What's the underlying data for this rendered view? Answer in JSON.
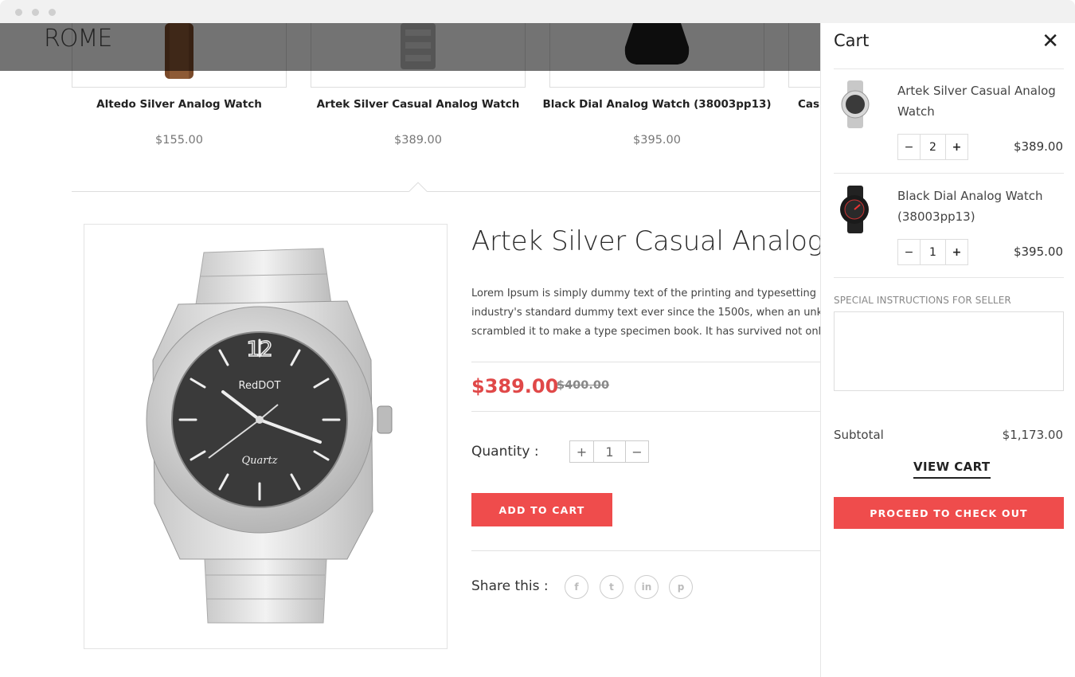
{
  "header": {
    "logo": "ROME"
  },
  "related": [
    {
      "name": "Altedo Silver Analog Watch",
      "price": "$155.00"
    },
    {
      "name": "Artek Silver Casual Analog Watch",
      "price": "$389.00"
    },
    {
      "name": "Black Dial Analog Watch (38003pp13)",
      "price": "$395.00"
    },
    {
      "name": "Casi",
      "price": ""
    }
  ],
  "product": {
    "title": "Artek Silver Casual Analog W",
    "description_lines": [
      "Lorem Ipsum is simply dummy text of the printing and typesetting indu",
      "industry's standard dummy text ever since the 1500s, when an unknow",
      "scrambled it to make a type specimen book. It has survived not only fiv"
    ],
    "price": "$389.00",
    "old_price": "$400.00",
    "quantity_label": "Quantity :",
    "quantity": "1",
    "plus": "+",
    "minus": "−",
    "add_to_cart": "ADD TO CART",
    "share_label": "Share this :",
    "share_icons": [
      "facebook-icon",
      "twitter-icon",
      "linkedin-icon",
      "pinterest-icon"
    ],
    "watch_brand": "RedDOT",
    "watch_sub": "Quartz",
    "watch_numeral": "12"
  },
  "cart": {
    "title": "Cart",
    "close": "✕",
    "items": [
      {
        "name": "Artek Silver Casual Analog Watch",
        "qty": "2",
        "price": "$389.00"
      },
      {
        "name": "Black Dial Analog Watch (38003pp13)",
        "qty": "1",
        "price": "$395.00"
      }
    ],
    "minus": "−",
    "plus": "+",
    "instructions_label": "SPECIAL INSTRUCTIONS FOR SELLER",
    "subtotal_label": "Subtotal",
    "subtotal": "$1,173.00",
    "view_cart": "VIEW CART",
    "checkout": "PROCEED TO CHECK OUT"
  },
  "colors": {
    "accent": "#ef4c4c",
    "price_red": "#e04848"
  }
}
